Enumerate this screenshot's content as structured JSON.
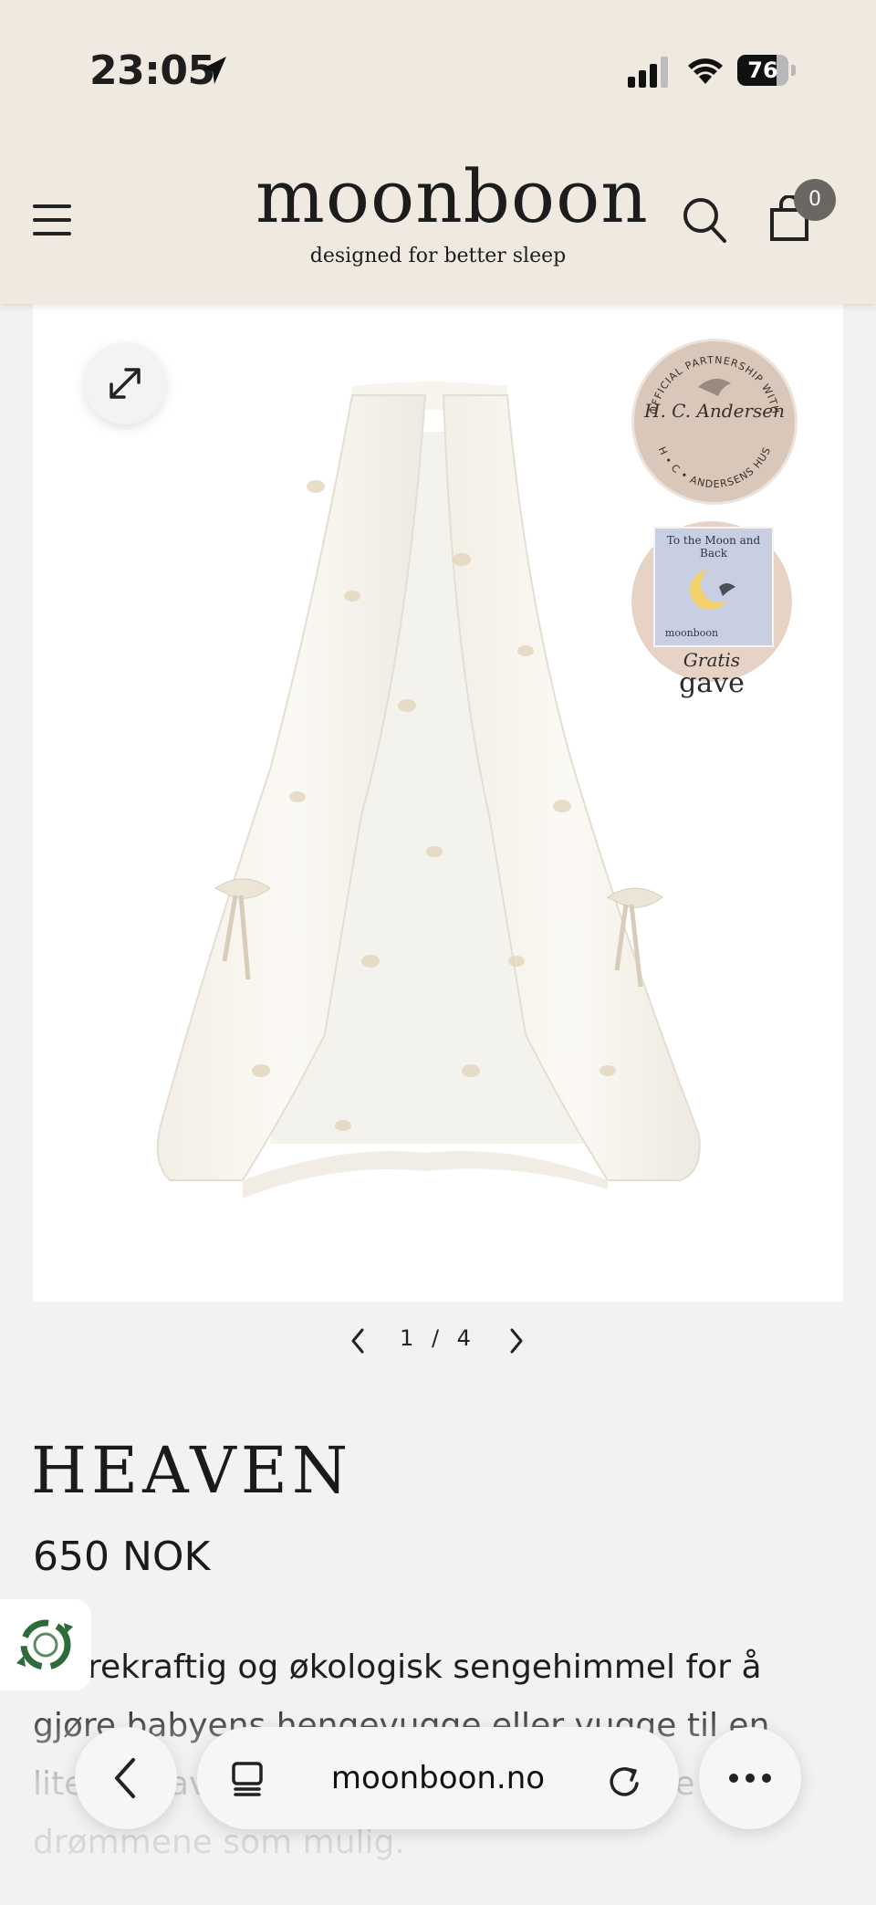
{
  "status_bar": {
    "time": "23:05",
    "battery": "76",
    "battery_level": 0.76
  },
  "header": {
    "logo": "moonboon",
    "tagline": "designed for better sleep",
    "cart_count": "0",
    "bg_color": "#f0e9df"
  },
  "gallery": {
    "badge_partnership_name": "H. C. Andersen",
    "badge_partnership_ring": "OFFICIAL PARTNERSHIP WITH · H • C • ANDERSENS HUS",
    "gift_book_title": "To the Moon and Back",
    "gift_book_brand": "moonboon",
    "gift_label_1": "Gratis",
    "gift_label_2": "gave",
    "pager": "1 / 4"
  },
  "product": {
    "title": "HEAVEN",
    "price": "650 NOK",
    "description": "Bærekraftig og økologisk sengehimmel for å gjøre babyens hengevugge eller vugge til en liten bit av himmelen og skape de beste drømmene som mulig."
  },
  "browser": {
    "url": "moonboon.no"
  },
  "icons": {
    "menu": "hamburger-icon",
    "search": "search-icon",
    "cart": "bag-icon",
    "expand": "expand-icon",
    "back": "chevron-left-icon",
    "more": "ellipsis-icon",
    "tabs": "tabs-icon",
    "reload": "reload-icon",
    "eco": "recycle-icon"
  }
}
